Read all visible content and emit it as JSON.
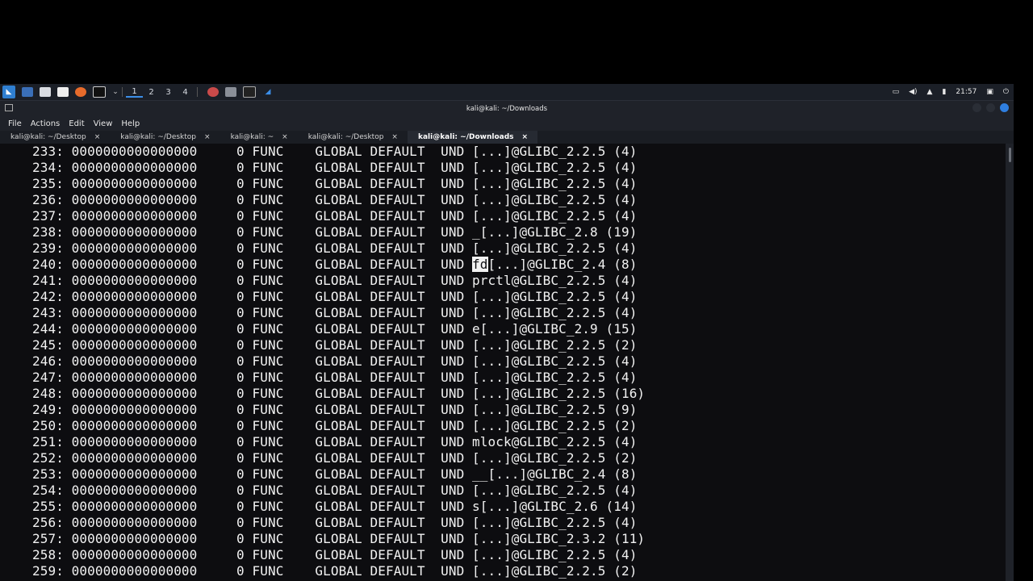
{
  "taskbar": {
    "workspaces": [
      "1",
      "2",
      "3",
      "4"
    ],
    "clock": "21:57",
    "icons": [
      "kali-menu-icon",
      "workspace-icon",
      "files-icon",
      "text-editor-icon",
      "firefox-icon",
      "terminal-icon",
      "chevron-down-icon",
      "app-icon",
      "app-icon",
      "terminal-app-icon",
      "app-icon"
    ],
    "tray_icons": [
      "display-icon",
      "volume-icon",
      "notification-icon",
      "battery-icon",
      "lock-icon",
      "power-icon"
    ]
  },
  "window": {
    "title": "kali@kali: ~/Downloads",
    "menu": [
      "File",
      "Actions",
      "Edit",
      "View",
      "Help"
    ],
    "tabs": [
      {
        "label": "kali@kali: ~/Desktop",
        "active": false
      },
      {
        "label": "kali@kali: ~/Desktop",
        "active": false
      },
      {
        "label": "kali@kali: ~",
        "active": false
      },
      {
        "label": "kali@kali: ~/Desktop",
        "active": false
      },
      {
        "label": "kali@kali: ~/Downloads",
        "active": true
      }
    ],
    "tab_close": "×"
  },
  "terminal": {
    "lines": [
      {
        "num": "233:",
        "value": "0000000000000000",
        "size": "0",
        "type": "FUNC",
        "bind": "GLOBAL",
        "vis": "DEFAULT",
        "ndx": "UND",
        "name": "[...]@GLIBC_2.2.5 (4)"
      },
      {
        "num": "234:",
        "value": "0000000000000000",
        "size": "0",
        "type": "FUNC",
        "bind": "GLOBAL",
        "vis": "DEFAULT",
        "ndx": "UND",
        "name": "[...]@GLIBC_2.2.5 (4)"
      },
      {
        "num": "235:",
        "value": "0000000000000000",
        "size": "0",
        "type": "FUNC",
        "bind": "GLOBAL",
        "vis": "DEFAULT",
        "ndx": "UND",
        "name": "[...]@GLIBC_2.2.5 (4)"
      },
      {
        "num": "236:",
        "value": "0000000000000000",
        "size": "0",
        "type": "FUNC",
        "bind": "GLOBAL",
        "vis": "DEFAULT",
        "ndx": "UND",
        "name": "[...]@GLIBC_2.2.5 (4)"
      },
      {
        "num": "237:",
        "value": "0000000000000000",
        "size": "0",
        "type": "FUNC",
        "bind": "GLOBAL",
        "vis": "DEFAULT",
        "ndx": "UND",
        "name": "[...]@GLIBC_2.2.5 (4)"
      },
      {
        "num": "238:",
        "value": "0000000000000000",
        "size": "0",
        "type": "FUNC",
        "bind": "GLOBAL",
        "vis": "DEFAULT",
        "ndx": "UND",
        "name": "_[...]@GLIBC_2.8 (19)"
      },
      {
        "num": "239:",
        "value": "0000000000000000",
        "size": "0",
        "type": "FUNC",
        "bind": "GLOBAL",
        "vis": "DEFAULT",
        "ndx": "UND",
        "name": "[...]@GLIBC_2.2.5 (4)"
      },
      {
        "num": "240:",
        "value": "0000000000000000",
        "size": "0",
        "type": "FUNC",
        "bind": "GLOBAL",
        "vis": "DEFAULT",
        "ndx": "UND",
        "name_hl": "fd",
        "name": "[...]@GLIBC_2.4 (8)"
      },
      {
        "num": "241:",
        "value": "0000000000000000",
        "size": "0",
        "type": "FUNC",
        "bind": "GLOBAL",
        "vis": "DEFAULT",
        "ndx": "UND",
        "name": "prctl@GLIBC_2.2.5 (4)"
      },
      {
        "num": "242:",
        "value": "0000000000000000",
        "size": "0",
        "type": "FUNC",
        "bind": "GLOBAL",
        "vis": "DEFAULT",
        "ndx": "UND",
        "name": "[...]@GLIBC_2.2.5 (4)"
      },
      {
        "num": "243:",
        "value": "0000000000000000",
        "size": "0",
        "type": "FUNC",
        "bind": "GLOBAL",
        "vis": "DEFAULT",
        "ndx": "UND",
        "name": "[...]@GLIBC_2.2.5 (4)"
      },
      {
        "num": "244:",
        "value": "0000000000000000",
        "size": "0",
        "type": "FUNC",
        "bind": "GLOBAL",
        "vis": "DEFAULT",
        "ndx": "UND",
        "name": "e[...]@GLIBC_2.9 (15)"
      },
      {
        "num": "245:",
        "value": "0000000000000000",
        "size": "0",
        "type": "FUNC",
        "bind": "GLOBAL",
        "vis": "DEFAULT",
        "ndx": "UND",
        "name": "[...]@GLIBC_2.2.5 (2)"
      },
      {
        "num": "246:",
        "value": "0000000000000000",
        "size": "0",
        "type": "FUNC",
        "bind": "GLOBAL",
        "vis": "DEFAULT",
        "ndx": "UND",
        "name": "[...]@GLIBC_2.2.5 (4)"
      },
      {
        "num": "247:",
        "value": "0000000000000000",
        "size": "0",
        "type": "FUNC",
        "bind": "GLOBAL",
        "vis": "DEFAULT",
        "ndx": "UND",
        "name": "[...]@GLIBC_2.2.5 (4)"
      },
      {
        "num": "248:",
        "value": "0000000000000000",
        "size": "0",
        "type": "FUNC",
        "bind": "GLOBAL",
        "vis": "DEFAULT",
        "ndx": "UND",
        "name": "[...]@GLIBC_2.2.5 (16)"
      },
      {
        "num": "249:",
        "value": "0000000000000000",
        "size": "0",
        "type": "FUNC",
        "bind": "GLOBAL",
        "vis": "DEFAULT",
        "ndx": "UND",
        "name": "[...]@GLIBC_2.2.5 (9)"
      },
      {
        "num": "250:",
        "value": "0000000000000000",
        "size": "0",
        "type": "FUNC",
        "bind": "GLOBAL",
        "vis": "DEFAULT",
        "ndx": "UND",
        "name": "[...]@GLIBC_2.2.5 (2)"
      },
      {
        "num": "251:",
        "value": "0000000000000000",
        "size": "0",
        "type": "FUNC",
        "bind": "GLOBAL",
        "vis": "DEFAULT",
        "ndx": "UND",
        "name": "mlock@GLIBC_2.2.5 (4)"
      },
      {
        "num": "252:",
        "value": "0000000000000000",
        "size": "0",
        "type": "FUNC",
        "bind": "GLOBAL",
        "vis": "DEFAULT",
        "ndx": "UND",
        "name": "[...]@GLIBC_2.2.5 (2)"
      },
      {
        "num": "253:",
        "value": "0000000000000000",
        "size": "0",
        "type": "FUNC",
        "bind": "GLOBAL",
        "vis": "DEFAULT",
        "ndx": "UND",
        "name": "__[...]@GLIBC_2.4 (8)"
      },
      {
        "num": "254:",
        "value": "0000000000000000",
        "size": "0",
        "type": "FUNC",
        "bind": "GLOBAL",
        "vis": "DEFAULT",
        "ndx": "UND",
        "name": "[...]@GLIBC_2.2.5 (4)"
      },
      {
        "num": "255:",
        "value": "0000000000000000",
        "size": "0",
        "type": "FUNC",
        "bind": "GLOBAL",
        "vis": "DEFAULT",
        "ndx": "UND",
        "name": "s[...]@GLIBC_2.6 (14)"
      },
      {
        "num": "256:",
        "value": "0000000000000000",
        "size": "0",
        "type": "FUNC",
        "bind": "GLOBAL",
        "vis": "DEFAULT",
        "ndx": "UND",
        "name": "[...]@GLIBC_2.2.5 (4)"
      },
      {
        "num": "257:",
        "value": "0000000000000000",
        "size": "0",
        "type": "FUNC",
        "bind": "GLOBAL",
        "vis": "DEFAULT",
        "ndx": "UND",
        "name": "[...]@GLIBC_2.3.2 (11)"
      },
      {
        "num": "258:",
        "value": "0000000000000000",
        "size": "0",
        "type": "FUNC",
        "bind": "GLOBAL",
        "vis": "DEFAULT",
        "ndx": "UND",
        "name": "[...]@GLIBC_2.2.5 (4)"
      },
      {
        "num": "259:",
        "value": "0000000000000000",
        "size": "0",
        "type": "FUNC",
        "bind": "GLOBAL",
        "vis": "DEFAULT",
        "ndx": "UND",
        "name": "[...]@GLIBC_2.2.5 (2)"
      }
    ]
  }
}
